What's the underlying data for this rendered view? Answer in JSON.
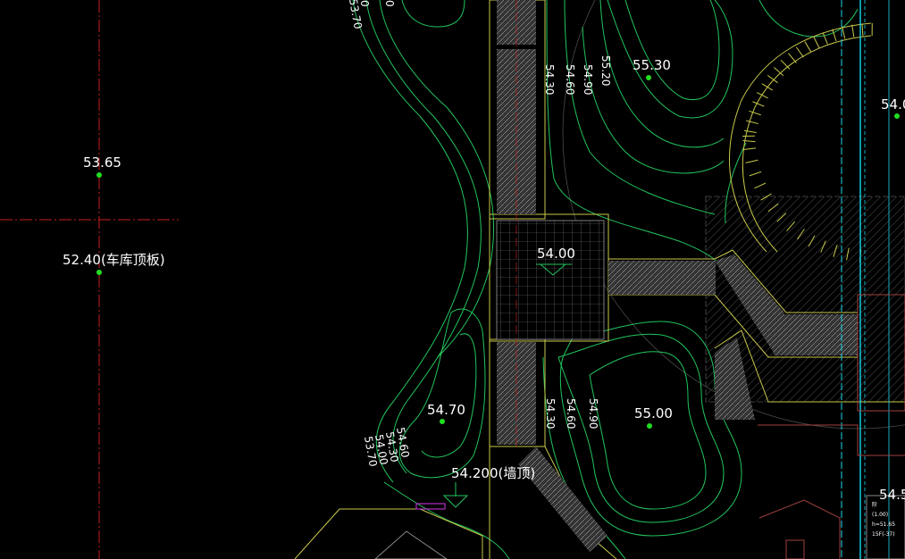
{
  "spot_elevations": {
    "e1": "53.65",
    "e2": "52.40(车库顶板)",
    "e3": "55.30",
    "e4": "54.00",
    "e5": "54.70",
    "e6": "55.00",
    "e7": "54.200(墙顶)",
    "e8": "54.0",
    "e9": "54.5"
  },
  "contour_labels": {
    "c1": "54.30",
    "c2": "54.60",
    "c3": "54.90",
    "c4": "55.20",
    "c5": "54.30",
    "c6": "54.60",
    "c7": "54.90",
    "c8": "54.60",
    "c9": "54.30",
    "c10": "54.00",
    "c11": "53.70",
    "c12": "53.70",
    "c13": "0",
    "c14": "0"
  },
  "legend_box": {
    "line1": "阶",
    "line2": "(1.00)",
    "line3": "h=51.65",
    "line4": "15F(-37)"
  },
  "colors": {
    "background": "#000000",
    "contour": "#22c55e",
    "spot": "#22dd22",
    "paving_edge": "#c8c84a",
    "axis_red": "#c81e1e",
    "cyan_line": "#18d8f0",
    "text": "#ffffff"
  }
}
